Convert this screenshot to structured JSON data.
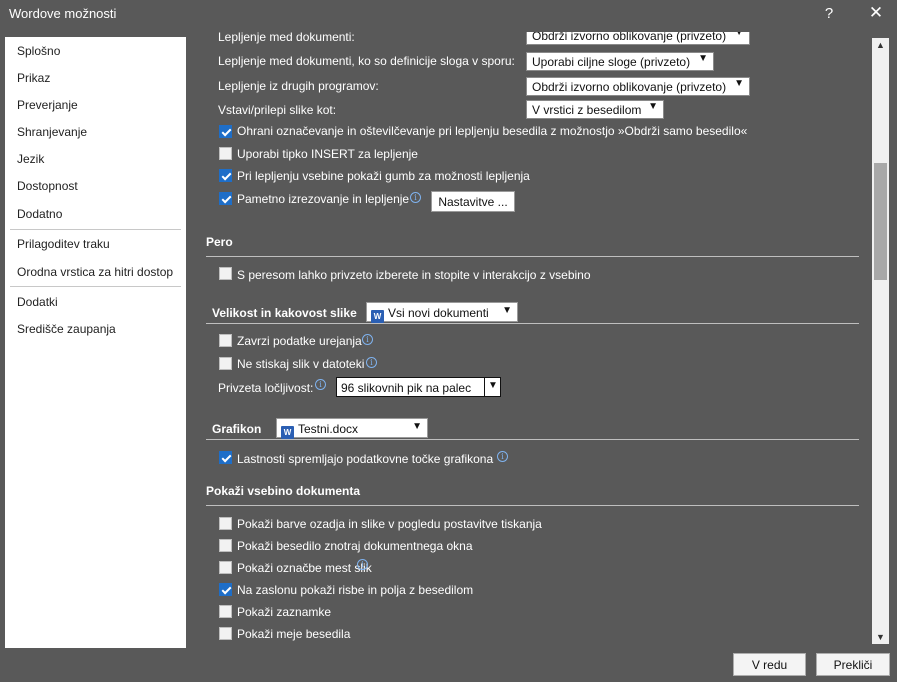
{
  "window": {
    "title": "Wordove možnosti",
    "help": "?",
    "close": "✕"
  },
  "sidebar": {
    "items": [
      {
        "label": "Splošno"
      },
      {
        "label": "Prikaz"
      },
      {
        "label": "Preverjanje"
      },
      {
        "label": "Shranjevanje"
      },
      {
        "label": "Jezik"
      },
      {
        "label": "Dostopnost"
      },
      {
        "label": "Dodatno"
      },
      {
        "label": "Prilagoditev traku"
      },
      {
        "label": "Orodna vrstica za hitri dostop"
      },
      {
        "label": "Dodatki"
      },
      {
        "label": "Središče zaupanja"
      }
    ]
  },
  "paste": {
    "rows": [
      {
        "label": "Lepljenje med dokumenti:",
        "value": "Obdrži izvorno oblikovanje (privzeto)"
      },
      {
        "label": "Lepljenje med dokumenti, ko so definicije sloga v sporu:",
        "value": "Uporabi ciljne sloge (privzeto)"
      },
      {
        "label": "Lepljenje iz drugih programov:",
        "value": "Obdrži izvorno oblikovanje (privzeto)"
      },
      {
        "label": "Vstavi/prilepi slike kot:",
        "value": "V vrstici z besedilom"
      }
    ],
    "checks": [
      {
        "label": "Ohrani označevanje in oštevilčevanje pri lepljenju besedila z možnostjo »Obdrži samo besedilo«",
        "checked": true
      },
      {
        "label": "Uporabi tipko INSERT za lepljenje",
        "checked": false
      },
      {
        "label": "Pri lepljenju vsebine pokaži gumb za možnosti lepljenja",
        "checked": true
      },
      {
        "label": "Pametno izrezovanje in lepljenje",
        "checked": true
      }
    ],
    "settings_button": "Nastavitve ..."
  },
  "pen": {
    "header": "Pero",
    "check": {
      "label": "S peresom lahko privzeto izberete in stopite v interakcijo z vsebino",
      "checked": false
    }
  },
  "image": {
    "header": "Velikost in kakovost slike",
    "doc_select": "Vsi novi dokumenti",
    "checks": [
      {
        "label": "Zavrzi podatke urejanja",
        "checked": false
      },
      {
        "label": "Ne stiskaj slik v datoteki",
        "checked": false
      }
    ],
    "resolution_label": "Privzeta ločljivost:",
    "resolution_value": "96 slikovnih pik na palec"
  },
  "chart": {
    "header": "Grafikon",
    "doc_select": "Testni.docx",
    "check": {
      "label": "Lastnosti spremljajo podatkovne točke grafikona",
      "checked": true
    }
  },
  "show": {
    "header": "Pokaži vsebino dokumenta",
    "checks": [
      {
        "label": "Pokaži barve ozadja in slike v pogledu postavitve tiskanja",
        "checked": false
      },
      {
        "label": "Pokaži besedilo znotraj dokumentnega okna",
        "checked": false
      },
      {
        "label": "Pokaži označbe mest slik",
        "checked": false
      },
      {
        "label": "Na zaslonu pokaži risbe in polja z besedilom",
        "checked": true
      },
      {
        "label": "Pokaži zaznamke",
        "checked": false
      },
      {
        "label": "Pokaži meje besedila",
        "checked": false
      }
    ]
  },
  "footer": {
    "ok": "V redu",
    "cancel": "Prekliči"
  },
  "icons": {
    "info": "info-icon",
    "dropdown": "chevron-down-icon",
    "word": "word-doc-icon"
  },
  "colors": {
    "checkbox_accent": "#1e6ec8",
    "window_bg": "#595959"
  }
}
